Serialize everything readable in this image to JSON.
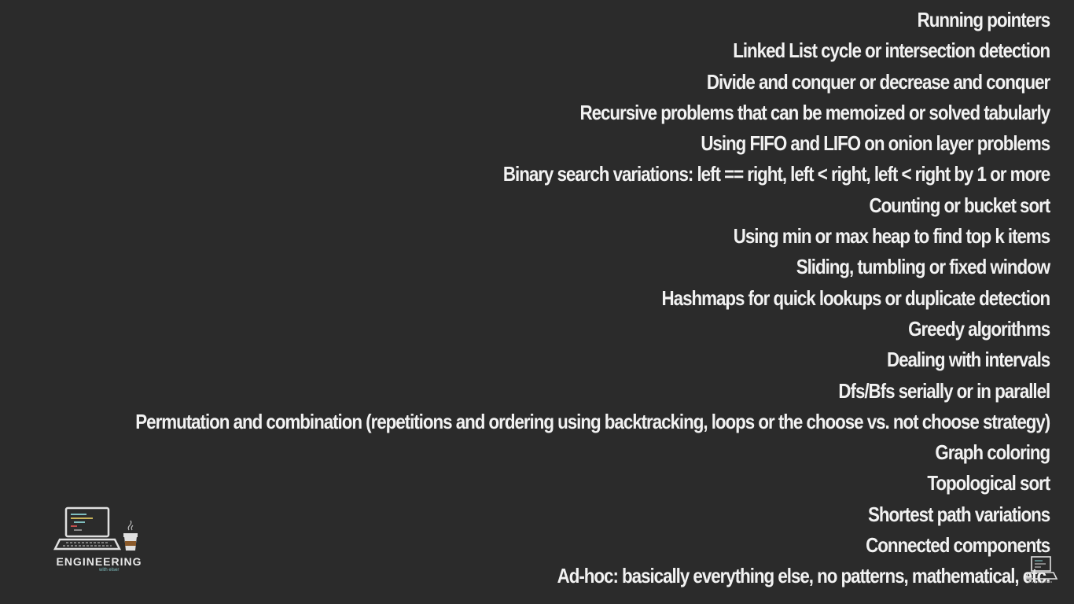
{
  "slide": {
    "topics": [
      "Running pointers",
      "Linked List cycle or intersection detection",
      "Divide and conquer or decrease and conquer",
      "Recursive problems that can be memoized or solved tabularly",
      "Using FIFO and LIFO on onion layer problems",
      "Binary search variations: left == right, left < right, left < right by 1 or more",
      "Counting or bucket sort",
      "Using min or max heap to find top k items",
      "Sliding, tumbling or fixed window",
      "Hashmaps for quick lookups or duplicate detection",
      "Greedy algorithms",
      "Dealing with intervals",
      "Dfs/Bfs serially or in parallel",
      "Permutation and combination (repetitions and ordering using backtracking, loops or the choose vs. not choose strategy)",
      "Graph coloring",
      "Topological sort",
      "Shortest path variations",
      "Connected components",
      "Ad-hoc: basically everything else, no patterns, mathematical, etc."
    ]
  },
  "logo": {
    "text": "ENGINEERING",
    "subtext": "with elser",
    "icon": "laptop-coffee-icon"
  },
  "corner_icon": "laptop-watermark-icon",
  "colors": {
    "background": "#2b2b2b",
    "text": "#f2f2f2",
    "logo_accent": "#7fbfbf"
  }
}
